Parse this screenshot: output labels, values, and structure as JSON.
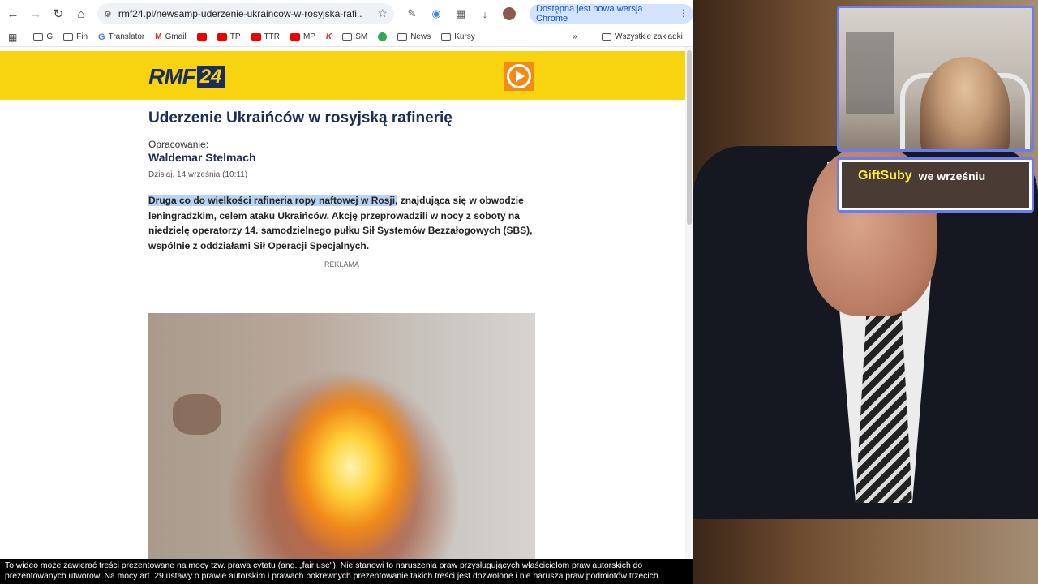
{
  "browser": {
    "url": "rmf24.pl/newsamp-uderzenie-ukraincow-w-rosyjska-rafi...",
    "update_notice": "Dostępna jest nowa wersja Chrome",
    "bookmarks": [
      "G",
      "Fin",
      "Translator",
      "Gmail",
      "TP",
      "TTR",
      "MP",
      "SM",
      "News",
      "Kursy"
    ],
    "all_bookmarks": "Wszystkie zakładki",
    "more_bookmarks": "»"
  },
  "article": {
    "title": "Uderzenie Ukraińców w rosyjską rafinerię",
    "byline_label": "Opracowanie:",
    "author": "Waldemar Stelmach",
    "date": "Dzisiaj, 14 września (10:11)",
    "lead_highlight": "Druga co do wielkości rafineria ropy naftowej w Rosji,",
    "lead_rest": " znajdująca się w obwodzie leningradzkim, celem ataku Ukraińców. Akcję przeprowadzili w nocy z soboty na niedzielę operatorzy 14. samodzielnego pułku Sił Systemów Bezzałogowych (SBS), wspólnie z oddziałami Sił Operacji Specjalnych.",
    "ad_label": "REKLAMA"
  },
  "site": {
    "logo_text": "RMF",
    "logo_number": "24"
  },
  "overlay": {
    "gift_name": "GiftSuby",
    "gift_text": "we wrześniu",
    "disclaimer": "To wideo może zawierać treści prezentowane na mocy tzw. prawa cytatu (ang. „fair use\"). Nie stanowi to naruszenia praw przysługujących właścicielom praw autorskich do prezentowanych utworów. Na mocy art. 29 ustawy o prawie autorskim i prawach pokrewnych prezentowanie takich treści jest dozwolone i nie narusza praw podmiotów trzecich."
  }
}
